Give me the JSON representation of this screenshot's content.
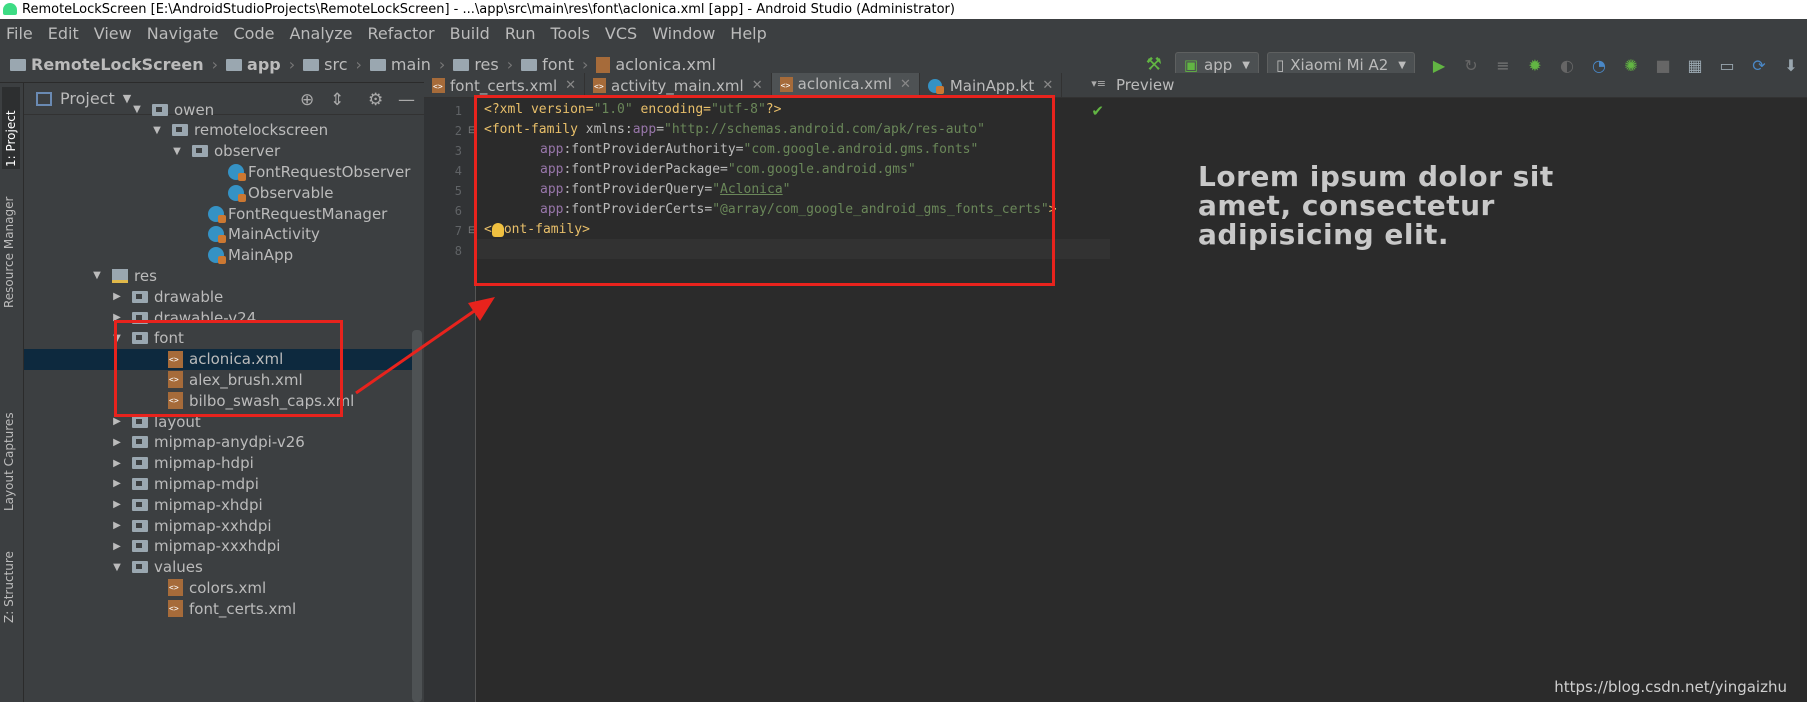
{
  "window": {
    "title": "RemoteLockScreen [E:\\AndroidStudioProjects\\RemoteLockScreen] - ...\\app\\src\\main\\res\\font\\aclonica.xml [app] - Android Studio (Administrator)"
  },
  "menu": [
    "File",
    "Edit",
    "View",
    "Navigate",
    "Code",
    "Analyze",
    "Refactor",
    "Build",
    "Run",
    "Tools",
    "VCS",
    "Window",
    "Help"
  ],
  "breadcrumbs": [
    "RemoteLockScreen",
    "app",
    "src",
    "main",
    "res",
    "font",
    "aclonica.xml"
  ],
  "toolbar": {
    "run_config": "app",
    "device": "Xiaomi Mi A2"
  },
  "left_strip": {
    "project": "1: Project",
    "resource_manager": "Resource Manager",
    "layout_captures": "Layout Captures",
    "structure": "Z: Structure"
  },
  "project_panel": {
    "title": "Project",
    "tree": [
      {
        "label": "owen",
        "kind": "package",
        "expanded": true
      },
      {
        "label": "remotelockscreen",
        "kind": "package",
        "expanded": true
      },
      {
        "label": "observer",
        "kind": "package",
        "expanded": true
      },
      {
        "label": "FontRequestObserver",
        "kind": "kotlin"
      },
      {
        "label": "Observable",
        "kind": "kotlin"
      },
      {
        "label": "FontRequestManager",
        "kind": "kotlin"
      },
      {
        "label": "MainActivity",
        "kind": "kotlin"
      },
      {
        "label": "MainApp",
        "kind": "kotlin"
      },
      {
        "label": "res",
        "kind": "res",
        "expanded": true
      },
      {
        "label": "drawable",
        "kind": "folder",
        "expanded": false
      },
      {
        "label": "drawable-v24",
        "kind": "folder",
        "expanded": false
      },
      {
        "label": "font",
        "kind": "folder",
        "expanded": true
      },
      {
        "label": "aclonica.xml",
        "kind": "xml",
        "selected": true
      },
      {
        "label": "alex_brush.xml",
        "kind": "xml"
      },
      {
        "label": "bilbo_swash_caps.xml",
        "kind": "xml"
      },
      {
        "label": "layout",
        "kind": "folder",
        "expanded": false
      },
      {
        "label": "mipmap-anydpi-v26",
        "kind": "folder",
        "expanded": false
      },
      {
        "label": "mipmap-hdpi",
        "kind": "folder",
        "expanded": false
      },
      {
        "label": "mipmap-mdpi",
        "kind": "folder",
        "expanded": false
      },
      {
        "label": "mipmap-xhdpi",
        "kind": "folder",
        "expanded": false
      },
      {
        "label": "mipmap-xxhdpi",
        "kind": "folder",
        "expanded": false
      },
      {
        "label": "mipmap-xxxhdpi",
        "kind": "folder",
        "expanded": false
      },
      {
        "label": "values",
        "kind": "folder",
        "expanded": true
      },
      {
        "label": "colors.xml",
        "kind": "xml"
      },
      {
        "label": "font_certs.xml",
        "kind": "xml"
      }
    ]
  },
  "editor_tabs": [
    {
      "label": "font_certs.xml",
      "kind": "xml",
      "active": false
    },
    {
      "label": "activity_main.xml",
      "kind": "xml",
      "active": false
    },
    {
      "label": "aclonica.xml",
      "kind": "xml",
      "active": true
    },
    {
      "label": "MainApp.kt",
      "kind": "kotlin",
      "active": false
    }
  ],
  "editor": {
    "line_numbers": [
      "1",
      "2",
      "3",
      "4",
      "5",
      "6",
      "7",
      "8"
    ],
    "lines": {
      "l1_a": "<?xml version=",
      "l1_b": "\"1.0\"",
      "l1_c": " encoding=",
      "l1_d": "\"utf-8\"",
      "l1_e": "?>",
      "l2_a": "<font-family ",
      "l2_b": "xmlns:",
      "l2_c": "app",
      "l2_d": "=",
      "l2_e": "\"http://schemas.android.com/apk/res-auto\"",
      "l3_a": "app",
      "l3_b": ":fontProviderAuthority=",
      "l3_c": "\"com.google.android.gms.fonts\"",
      "l4_a": "app",
      "l4_b": ":fontProviderPackage=",
      "l4_c": "\"com.google.android.gms\"",
      "l5_a": "app",
      "l5_b": ":fontProviderQuery=",
      "l5_c": "\"",
      "l5_d": "Aclonica",
      "l5_e": "\"",
      "l6_a": "app",
      "l6_b": ":fontProviderCerts=",
      "l6_c": "\"@array/com_google_android_gms_fonts_certs\"",
      "l6_d": ">",
      "l7_a": "<",
      "l7_b": "ont-family>"
    }
  },
  "preview": {
    "title": "Preview",
    "text": "Lorem ipsum dolor sit amet, consectetur adipisicing elit."
  },
  "watermark": "https://blog.csdn.net/yingaizhu",
  "colors": {
    "annotation": "#e8231d",
    "selection": "#0d293e",
    "accent": "#4a88c7"
  }
}
